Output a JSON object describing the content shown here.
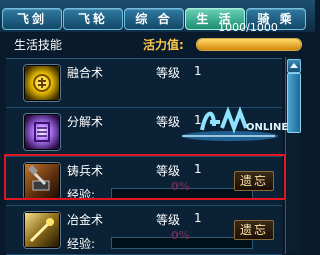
{
  "tabs": [
    {
      "label": "飞剑",
      "active": false
    },
    {
      "label": "飞轮",
      "active": false
    },
    {
      "label": "综 合",
      "active": false
    },
    {
      "label": "生 活",
      "active": true
    },
    {
      "label": "骑 乘",
      "active": false
    }
  ],
  "header": {
    "title": "生活技能",
    "vitality_label": "活力值:",
    "vitality_text": "1000/1000",
    "vitality_fraction": 1.0
  },
  "skills": [
    {
      "name": "融合术",
      "level_label": "等级",
      "level": "1",
      "icon": "fusion-icon"
    },
    {
      "name": "分解术",
      "level_label": "等级",
      "level": "1",
      "icon": "disassemble-icon"
    },
    {
      "name": "铸兵术",
      "level_label": "等级",
      "level": "1",
      "icon": "weapon-forging-icon",
      "exp_label": "经验:",
      "exp_percent": "0%",
      "exp_fraction": 0,
      "forget_label": "遗忘",
      "selected": true
    },
    {
      "name": "冶金术",
      "level_label": "等级",
      "level": "1",
      "icon": "metallurgy-icon",
      "exp_label": "经验:",
      "exp_percent": "0%",
      "exp_fraction": 0,
      "forget_label": "遗忘"
    }
  ],
  "watermark": {
    "text": "ONLINE"
  },
  "colors": {
    "selected_border": "#e0171f",
    "active_tab": "#3fb393",
    "vitality_bar": "#e8a723"
  }
}
